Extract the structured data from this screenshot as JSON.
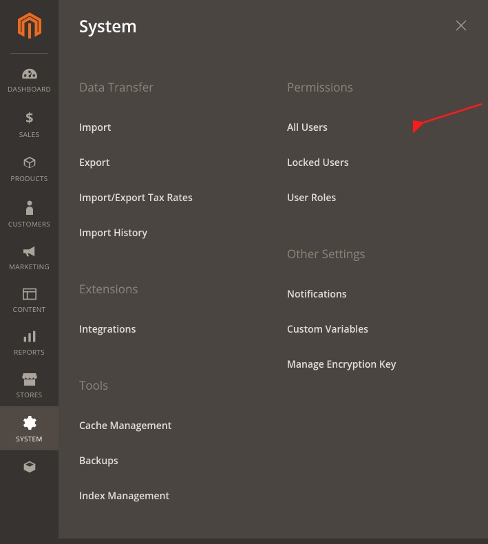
{
  "panelTitle": "System",
  "nav": {
    "dashboard": "DASHBOARD",
    "sales": "SALES",
    "products": "PRODUCTS",
    "customers": "CUSTOMERS",
    "marketing": "MARKETING",
    "content": "CONTENT",
    "reports": "REPORTS",
    "stores": "STORES",
    "system": "SYSTEM"
  },
  "sections": {
    "dataTransfer": {
      "title": "Data Transfer",
      "import": "Import",
      "export": "Export",
      "taxRates": "Import/Export Tax Rates",
      "history": "Import History"
    },
    "extensions": {
      "title": "Extensions",
      "integrations": "Integrations"
    },
    "tools": {
      "title": "Tools",
      "cache": "Cache Management",
      "backups": "Backups",
      "index": "Index Management"
    },
    "permissions": {
      "title": "Permissions",
      "allUsers": "All Users",
      "lockedUsers": "Locked Users",
      "userRoles": "User Roles"
    },
    "otherSettings": {
      "title": "Other Settings",
      "notifications": "Notifications",
      "customVars": "Custom Variables",
      "encryption": "Manage Encryption Key"
    }
  }
}
